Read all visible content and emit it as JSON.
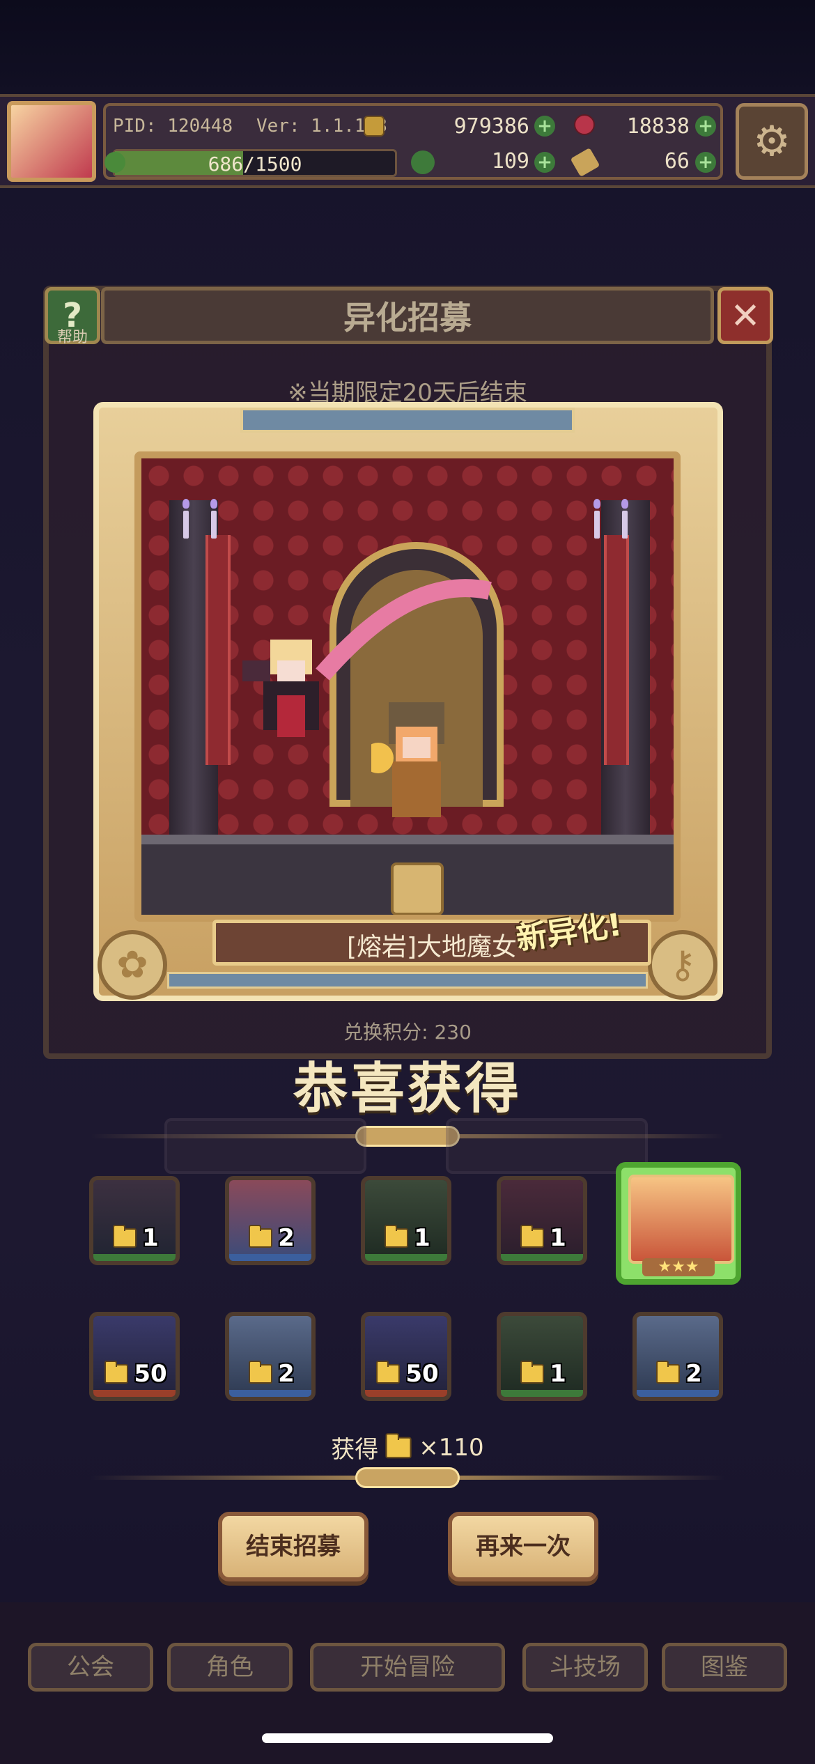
{
  "header": {
    "pid_label": "PID: 120448",
    "version_label": "Ver: 1.1.1.8",
    "gold": "979386",
    "gems": "18838",
    "clover": "109",
    "keys": "66",
    "xp_text": "686/1500",
    "xp_progress": 0.457
  },
  "window": {
    "title": "异化招募",
    "help_label": "帮助",
    "limited_notice": "※当期限定20天后结束",
    "points_label": "兑换积分: 230"
  },
  "reward": {
    "character_name": "[熔岩]大地魔女",
    "new_tag": "新异化!",
    "congrats": "恭喜获得",
    "stars": "★★★"
  },
  "tiles": [
    {
      "count": "1",
      "rarity": "green"
    },
    {
      "count": "2",
      "rarity": "blue"
    },
    {
      "count": "1",
      "rarity": "green"
    },
    {
      "count": "1",
      "rarity": "green"
    },
    {
      "count": "",
      "rarity": "featured"
    },
    {
      "count": "50",
      "rarity": "red"
    },
    {
      "count": "2",
      "rarity": "blue"
    },
    {
      "count": "50",
      "rarity": "red"
    },
    {
      "count": "1",
      "rarity": "green"
    },
    {
      "count": "2",
      "rarity": "blue"
    }
  ],
  "summary": {
    "obtained_label": "获得",
    "obtained_count": "×110"
  },
  "actions": {
    "end_label": "结束招募",
    "again_label": "再来一次"
  },
  "nav": {
    "guild": "公会",
    "characters": "角色",
    "adventure": "开始冒险",
    "arena": "斗技场",
    "codex": "图鉴"
  },
  "colors": {
    "rarity_green": "#3d7a3a",
    "rarity_blue": "#3b5f9e",
    "rarity_red": "#9a3f2a",
    "accent_gold": "#e8cf9a"
  }
}
